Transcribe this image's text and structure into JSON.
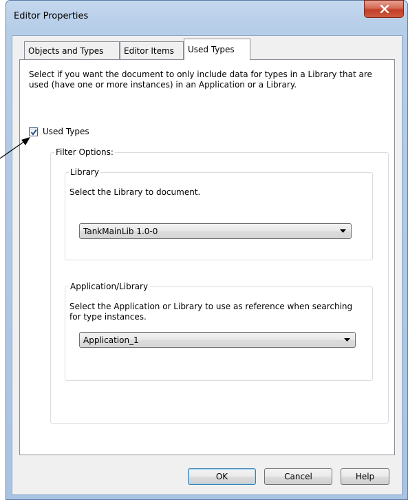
{
  "window": {
    "title": "Editor Properties",
    "close_glyph": "close-icon"
  },
  "tabs": [
    {
      "label": "Objects and Types"
    },
    {
      "label": "Editor Items"
    },
    {
      "label": "Used Types",
      "active": true
    }
  ],
  "used_types": {
    "description": "Select if you want the document to only include data for types in a Library that are used (have one or more instances) in an Application or a Library.",
    "checkbox_label": "Used Types",
    "checked": true,
    "filter_options_label": "Filter Options:",
    "library": {
      "group_label": "Library",
      "prompt": "Select the Library to document.",
      "selected": "TankMainLib 1.0-0"
    },
    "application": {
      "group_label": "Application/Library",
      "prompt": "Select the Application or Library to use as reference when searching for type instances.",
      "selected": "Application_1"
    }
  },
  "buttons": {
    "ok": "OK",
    "cancel": "Cancel",
    "help": "Help"
  },
  "colors": {
    "title_bar": "#b9cfe9",
    "close_button": "#c9452d",
    "default_button_border": "#3c7fb1"
  }
}
